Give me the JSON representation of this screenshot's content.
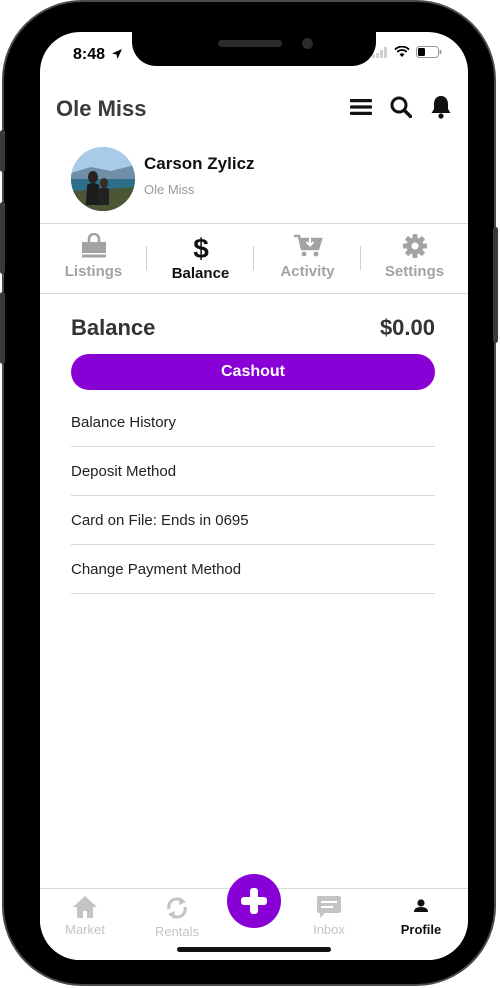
{
  "status": {
    "time": "8:48"
  },
  "header": {
    "title": "Ole Miss"
  },
  "profile": {
    "name": "Carson Zylicz",
    "school": "Ole Miss"
  },
  "tabs": [
    {
      "label": "Listings",
      "icon": "shopping-bag-icon",
      "active": false
    },
    {
      "label": "Balance",
      "icon": "dollar-icon",
      "active": true
    },
    {
      "label": "Activity",
      "icon": "cart-download-icon",
      "active": false
    },
    {
      "label": "Settings",
      "icon": "gear-icon",
      "active": false
    }
  ],
  "balance": {
    "title": "Balance",
    "amount": "$0.00",
    "cashout_label": "Cashout",
    "items": [
      {
        "label": "Balance History"
      },
      {
        "label": "Deposit Method"
      },
      {
        "label": "Card on File: Ends in 0695"
      },
      {
        "label": "Change Payment Method"
      }
    ]
  },
  "bottom_nav": [
    {
      "label": "Market",
      "icon": "home-icon"
    },
    {
      "label": "Rentals",
      "icon": "refresh-icon"
    },
    {
      "label": "Inbox",
      "icon": "chat-icon"
    },
    {
      "label": "Profile",
      "icon": "person-icon",
      "active": true
    }
  ],
  "colors": {
    "accent": "#8800d6",
    "inactive": "#a3a3a3",
    "text": "#333333"
  }
}
